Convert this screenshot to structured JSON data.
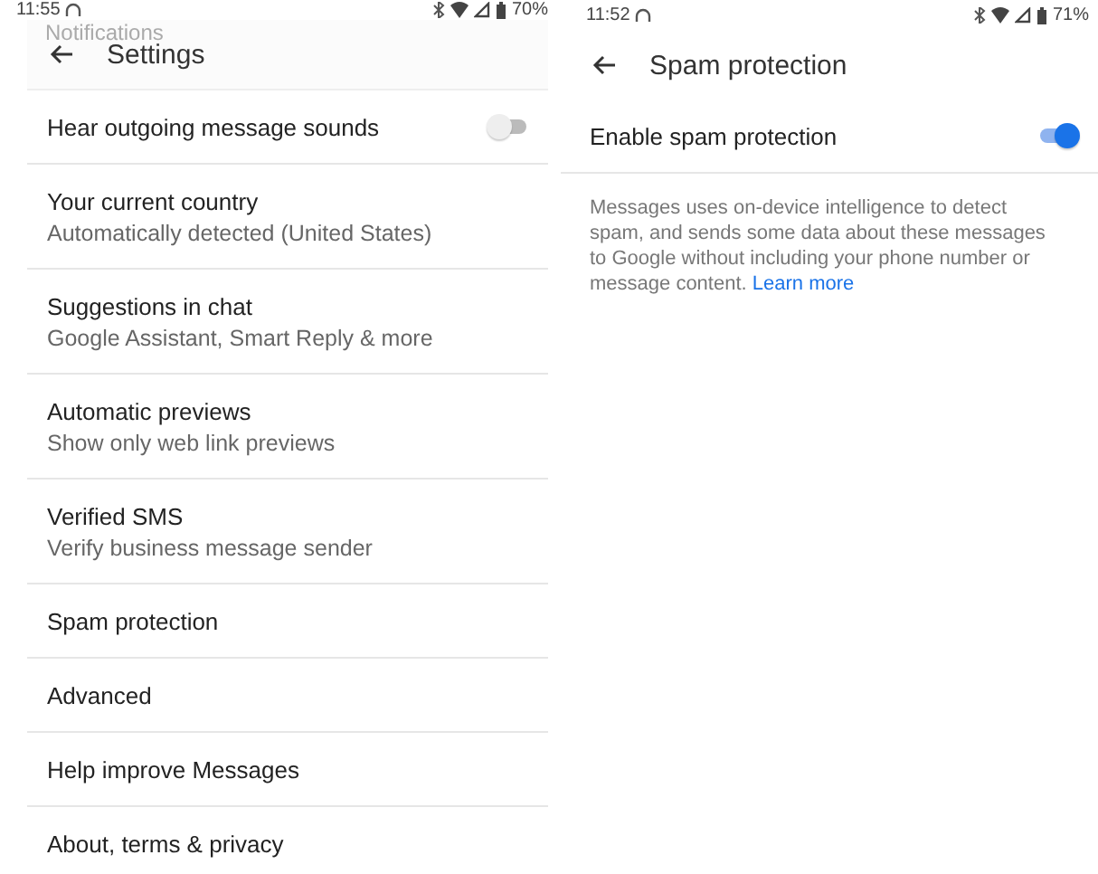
{
  "screens": [
    {
      "status_bar": {
        "time": "11:55",
        "battery": "70%"
      },
      "ghost_text": "Notifications",
      "title": "Settings",
      "items": [
        {
          "kind": "switch",
          "title": "Hear outgoing message sounds",
          "on": false
        },
        {
          "kind": "text",
          "title": "Your current country",
          "subtitle": "Automatically detected (United States)"
        },
        {
          "kind": "text",
          "title": "Suggestions in chat",
          "subtitle": "Google Assistant, Smart Reply & more"
        },
        {
          "kind": "text",
          "title": "Automatic previews",
          "subtitle": "Show only web link previews"
        },
        {
          "kind": "text",
          "title": "Verified SMS",
          "subtitle": "Verify business message sender"
        },
        {
          "kind": "text",
          "title": "Spam protection"
        },
        {
          "kind": "text",
          "title": "Advanced"
        },
        {
          "kind": "text",
          "title": "Help improve Messages"
        },
        {
          "kind": "text",
          "title": "About, terms & privacy"
        }
      ]
    },
    {
      "status_bar": {
        "time": "11:52",
        "battery": "71%"
      },
      "title": "Spam protection",
      "items": [
        {
          "kind": "switch",
          "title": "Enable spam protection",
          "on": true
        }
      ],
      "description": "Messages uses on-device intelligence to detect spam, and sends some data about these messages to Google without including your phone number or message content.",
      "link": "Learn more"
    }
  ]
}
